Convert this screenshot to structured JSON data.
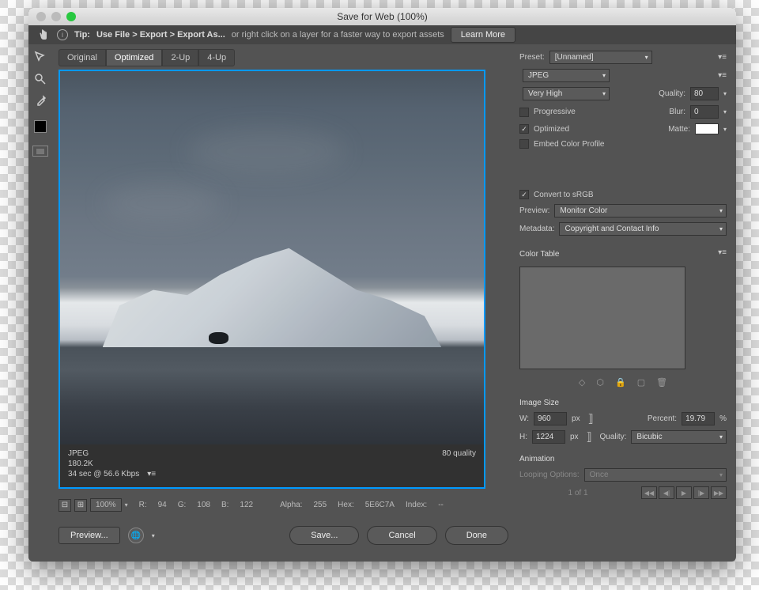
{
  "window": {
    "title": "Save for Web (100%)"
  },
  "tipbar": {
    "tip_label": "Tip:",
    "tip_path": "Use File > Export > Export As...",
    "tip_rest": "or right click on a layer for a faster way to export assets",
    "learn_more": "Learn More"
  },
  "tabs": {
    "original": "Original",
    "optimized": "Optimized",
    "two_up": "2-Up",
    "four_up": "4-Up"
  },
  "preview_info": {
    "format": "JPEG",
    "size": "180.2K",
    "time": "34 sec @ 56.6 Kbps",
    "quality": "80 quality"
  },
  "footer": {
    "zoom": "100%",
    "r_label": "R:",
    "r": "94",
    "g_label": "G:",
    "g": "108",
    "b_label": "B:",
    "b": "122",
    "alpha_label": "Alpha:",
    "alpha": "255",
    "hex_label": "Hex:",
    "hex": "5E6C7A",
    "index_label": "Index:",
    "index": "--"
  },
  "buttons": {
    "preview": "Preview...",
    "save": "Save...",
    "cancel": "Cancel",
    "done": "Done"
  },
  "settings": {
    "preset_label": "Preset:",
    "preset_value": "[Unnamed]",
    "format": "JPEG",
    "quality_preset": "Very High",
    "quality_label": "Quality:",
    "quality_value": "80",
    "progressive": "Progressive",
    "blur_label": "Blur:",
    "blur_value": "0",
    "optimized": "Optimized",
    "matte_label": "Matte:",
    "embed_profile": "Embed Color Profile",
    "convert_srgb": "Convert to sRGB",
    "preview_label": "Preview:",
    "preview_value": "Monitor Color",
    "metadata_label": "Metadata:",
    "metadata_value": "Copyright and Contact Info",
    "color_table": "Color Table"
  },
  "image_size": {
    "header": "Image Size",
    "w_label": "W:",
    "w": "960",
    "h_label": "H:",
    "h": "1224",
    "px": "px",
    "percent_label": "Percent:",
    "percent": "19.79",
    "percent_sym": "%",
    "qual_label": "Quality:",
    "qual_value": "Bicubic"
  },
  "animation": {
    "header": "Animation",
    "loop_label": "Looping Options:",
    "loop_value": "Once",
    "frame": "1 of 1"
  }
}
